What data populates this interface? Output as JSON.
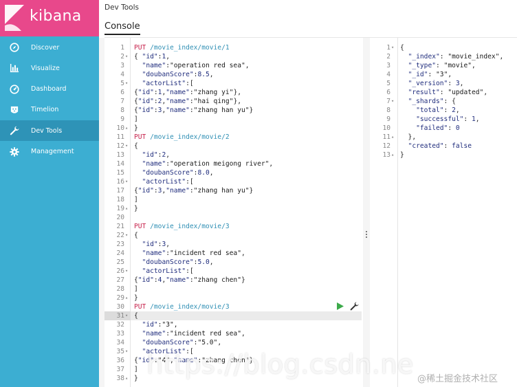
{
  "brand": {
    "name": "kibana",
    "color": "#e8488b",
    "sidebar_color": "#3caed2"
  },
  "sidebar": {
    "items": [
      {
        "label": "Discover",
        "icon": "compass-icon",
        "active": false
      },
      {
        "label": "Visualize",
        "icon": "bar-chart-icon",
        "active": false
      },
      {
        "label": "Dashboard",
        "icon": "dashboard-icon",
        "active": false
      },
      {
        "label": "Timelion",
        "icon": "timelion-icon",
        "active": false
      },
      {
        "label": "Dev Tools",
        "icon": "wrench-icon",
        "active": true
      },
      {
        "label": "Management",
        "icon": "gear-icon",
        "active": false
      }
    ]
  },
  "header": {
    "title": "Dev Tools",
    "tab": "Console"
  },
  "editor": {
    "highlighted_line": 31,
    "request_line": 30,
    "lines": [
      "PUT /movie_index/movie/1",
      "{ \"id\":1,",
      "  \"name\":\"operation red sea\",",
      "  \"doubanScore\":8.5,",
      "  \"actorList\":[",
      "{\"id\":1,\"name\":\"zhang yi\"},",
      "{\"id\":2,\"name\":\"hai qing\"},",
      "{\"id\":3,\"name\":\"zhang han yu\"}",
      "]",
      "}",
      "PUT /movie_index/movie/2",
      "{",
      "  \"id\":2,",
      "  \"name\":\"operation meigong river\",",
      "  \"doubanScore\":8.0,",
      "  \"actorList\":[",
      "{\"id\":3,\"name\":\"zhang han yu\"}",
      "]",
      "}",
      "",
      "PUT /movie_index/movie/3",
      "{",
      "  \"id\":3,",
      "  \"name\":\"incident red sea\",",
      "  \"doubanScore\":5.0,",
      "  \"actorList\":[",
      "{\"id\":4,\"name\":\"zhang chen\"}",
      "]",
      "}",
      "PUT /movie_index/movie/3",
      "{",
      "  \"id\":\"3\",",
      "  \"name\":\"incident red sea\",",
      "  \"doubanScore\":\"5.0\",",
      "  \"actorList\":[",
      "{\"id\":\"4\",\"name\":\"zhang chen\"}",
      "]",
      "}"
    ],
    "fold_lines": [
      2,
      5,
      10,
      12,
      16,
      19,
      22,
      26,
      29,
      31,
      35,
      38
    ]
  },
  "output": {
    "lines": [
      "{",
      "  \"_index\": \"movie_index\",",
      "  \"_type\": \"movie\",",
      "  \"_id\": \"3\",",
      "  \"_version\": 3,",
      "  \"result\": \"updated\",",
      "  \"_shards\": {",
      "    \"total\": 2,",
      "    \"successful\": 1,",
      "    \"failed\": 0",
      "  },",
      "  \"created\": false",
      "}"
    ],
    "fold_lines": [
      1,
      7,
      11,
      13
    ]
  },
  "watermark": "https://blog.csdn.ne",
  "corner_mark": "@稀土掘金技术社区"
}
